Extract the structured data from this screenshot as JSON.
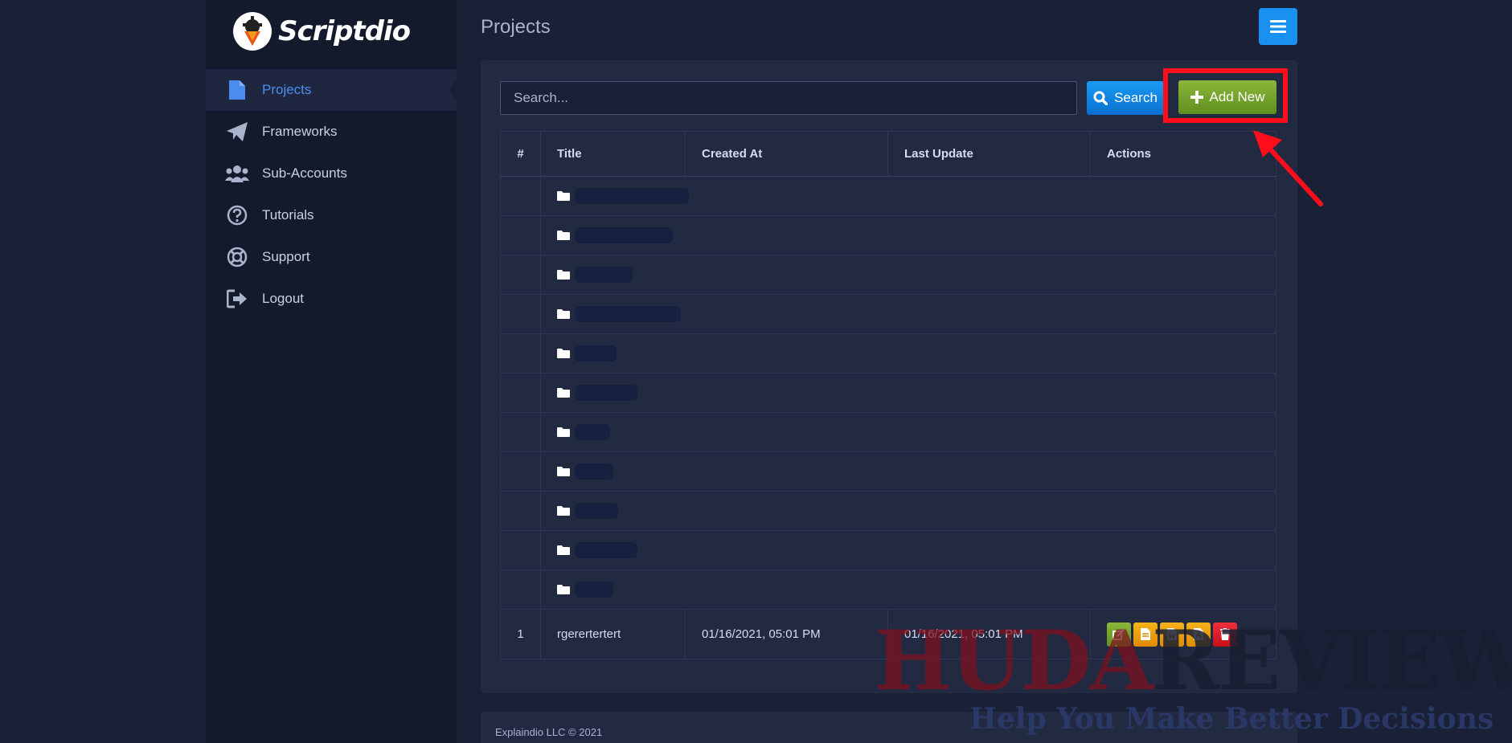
{
  "app": {
    "name": "Scriptdio"
  },
  "sidebar": {
    "items": [
      {
        "label": "Projects",
        "icon": "file-icon",
        "active": true
      },
      {
        "label": "Frameworks",
        "icon": "paper-plane-icon"
      },
      {
        "label": "Sub-Accounts",
        "icon": "users-icon"
      },
      {
        "label": "Tutorials",
        "icon": "question-circle-icon"
      },
      {
        "label": "Support",
        "icon": "life-ring-icon"
      },
      {
        "label": "Logout",
        "icon": "sign-out-icon"
      }
    ]
  },
  "header": {
    "title": "Projects",
    "menu_icon": "hamburger-icon"
  },
  "toolbar": {
    "search_placeholder": "Search...",
    "search_label": "Search",
    "add_label": "Add New"
  },
  "table": {
    "columns": [
      "#",
      "Title",
      "Created At",
      "Last Update",
      "Actions"
    ],
    "folder_rows": 11,
    "rows": [
      {
        "num": "1",
        "title": "rgerertertert",
        "created": "01/16/2021, 05:01 PM",
        "updated": "01/16/2021, 05:01 PM"
      }
    ]
  },
  "footer": {
    "text": "Explaindio LLC © 2021"
  },
  "watermark": {
    "brand_left": "HUDA",
    "brand_right": "REVIEW",
    "tagline": "Help You Make Better Decisions"
  },
  "colors": {
    "accent": "#4a8cf0",
    "search": "#1a90f0",
    "add": "#7aa82c",
    "highlight": "#ff0d1a"
  }
}
